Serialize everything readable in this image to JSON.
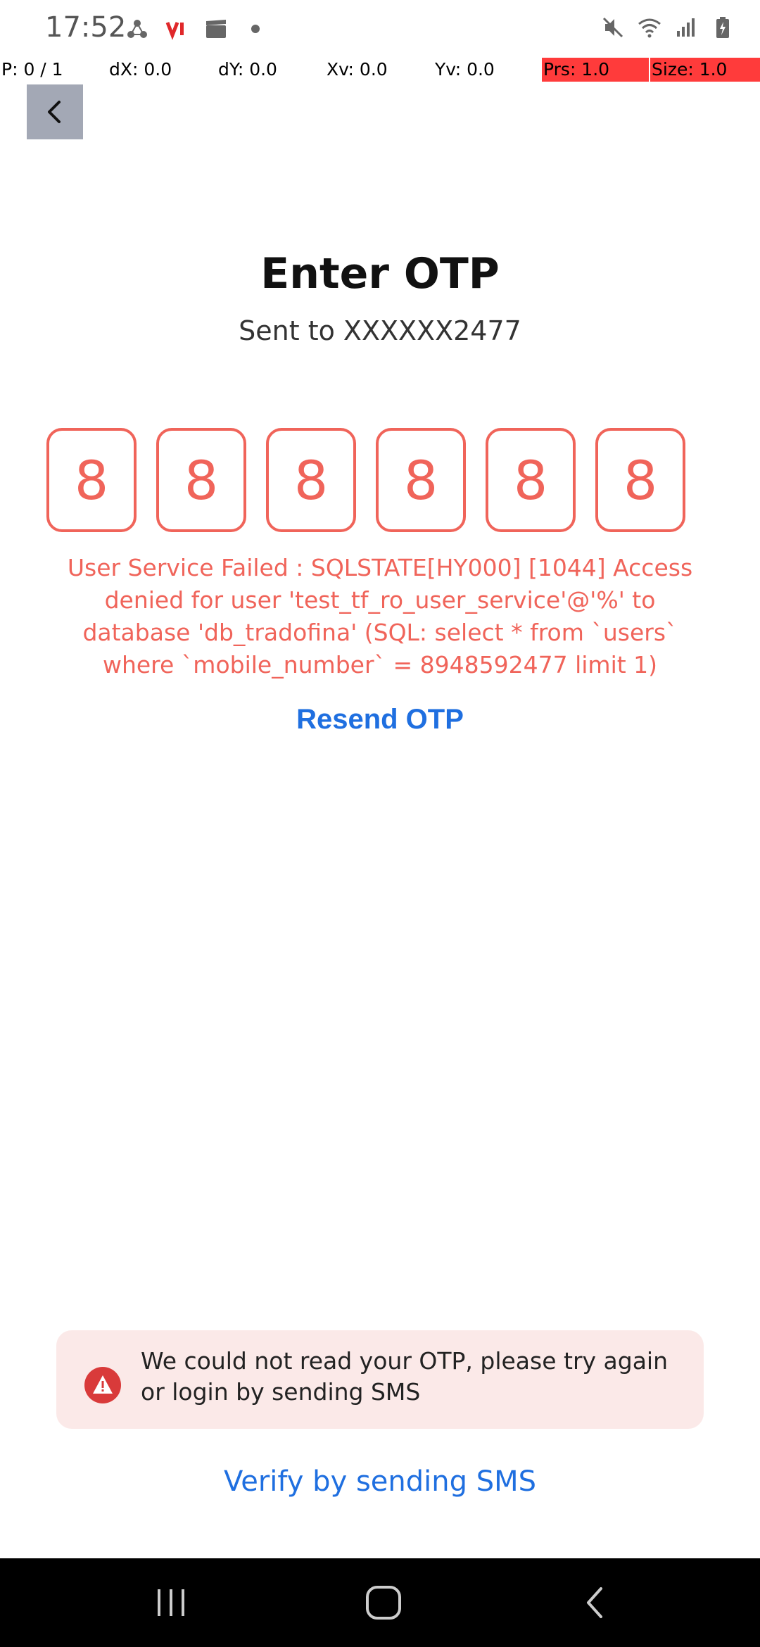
{
  "status_bar": {
    "time": "17:52",
    "left_icons": [
      "share-icon",
      "vi-logo-icon",
      "clapper-icon",
      "dot-icon"
    ],
    "right_icons": [
      "mute-icon",
      "wifi-icon",
      "signal-icon",
      "battery-icon"
    ]
  },
  "pointer_overlay": {
    "p": "P: 0 / 1",
    "dx": "dX: 0.0",
    "dy": "dY: 0.0",
    "xv": "Xv: 0.0",
    "yv": "Yv: 0.0",
    "prs": "Prs: 1.0",
    "size": "Size: 1.0"
  },
  "header": {
    "back_icon": "chevron-left-icon"
  },
  "main": {
    "title": "Enter OTP",
    "subtitle": "Sent to XXXXXX2477",
    "otp_digits": [
      "8",
      "8",
      "8",
      "8",
      "8",
      "8"
    ],
    "error_message": "User Service Failed : SQLSTATE[HY000] [1044] Access denied for user 'test_tf_ro_user_service'@'%' to database 'db_tradofina' (SQL: select * from `users` where `mobile_number` = 8948592477 limit 1)",
    "resend_label": "Resend OTP"
  },
  "toast": {
    "icon": "warning-icon",
    "message": "We could not read your OTP, please try again or login by sending SMS"
  },
  "footer": {
    "verify_label": "Verify by sending SMS"
  },
  "nav_bar": {
    "recents_icon": "recents-icon",
    "home_icon": "home-icon",
    "back_icon": "back-icon"
  },
  "colors": {
    "accent_error": "#f0645a",
    "link_blue": "#1f6fe0",
    "toast_bg": "#fbe9e8",
    "overlay_red": "#ff3b3b"
  }
}
